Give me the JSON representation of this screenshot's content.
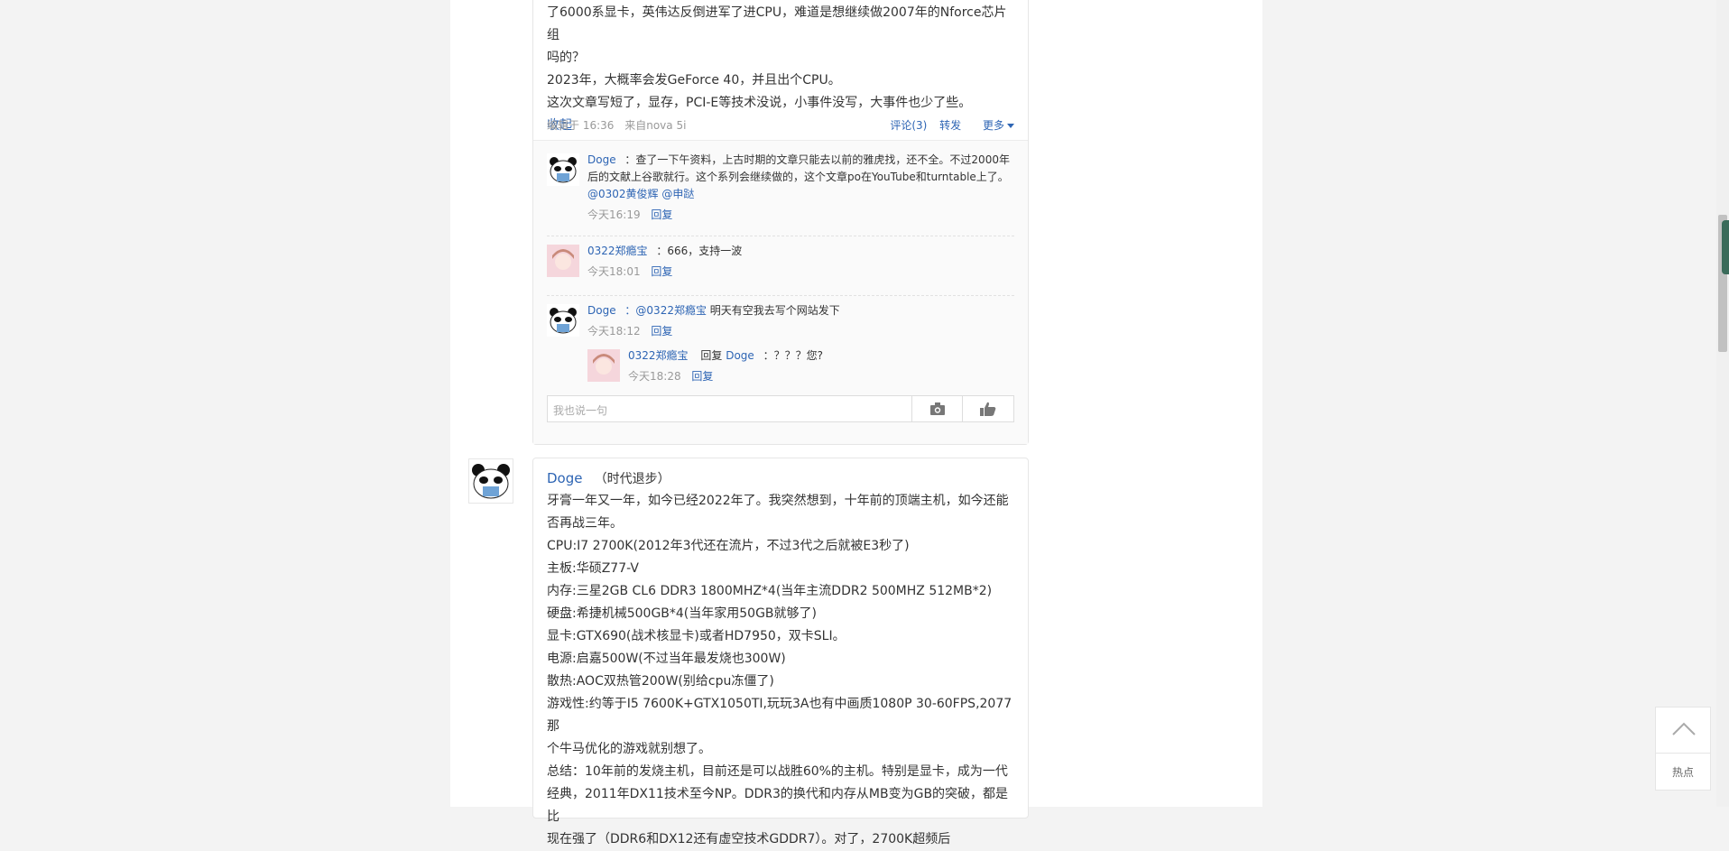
{
  "post1": {
    "lines": [
      "了6000系显卡，英伟达反倒进军了进CPU，难道是想继续做2007年的Nforce芯片组",
      "吗的？",
      " 2023年，大概率会发GeForce 40，并且出个CPU。",
      "这次文章写短了，显存，PCI-E等技术没说，小事件没写，大事件也少了些。"
    ],
    "collapse": "收起",
    "edited": "编辑于 16:36",
    "source": "来自nova 5i",
    "comments_link": "评论(3)",
    "forward_link": "转发",
    "more_link": "更多"
  },
  "comments": [
    {
      "user": "Doge",
      "text": "：查了一下午资料，上古时期的文章只能去以前的雅虎找，还不全。不过2000年后的文献上谷歌就行。这个系列会继续做的，这个文章po在YouTube和turntable上了。",
      "mentions": "@0302黄俊辉 @申跶",
      "time": "今天16:19",
      "reply": "回复"
    },
    {
      "user": "0322郑瘾宝",
      "text": "：666，支持一波",
      "time": "今天18:01",
      "reply": "回复"
    },
    {
      "user": "Doge",
      "mention": "：@0322郑瘾宝",
      "text": " 明天有空我去写个网站发下",
      "time": "今天18:12",
      "reply": "回复"
    },
    {
      "user": "0322郑瘾宝",
      "reply_word": "回复",
      "reply_to": "Doge",
      "text": "：？？？您?",
      "time": "今天18:28",
      "reply": "回复"
    }
  ],
  "reply_input": {
    "placeholder": "我也说一句"
  },
  "post2": {
    "author": "Doge",
    "tag": "（时代退步）",
    "lines": [
      "牙膏一年又一年，如今已经2022年了。我突然想到，十年前的顶端主机，如今还能",
      "否再战三年。",
      "CPU:I7 2700K(2012年3代还在流片，不过3代之后就被E3秒了)",
      "主板:华硕Z77-V",
      "内存:三星2GB CL6 DDR3 1800MHZ*4(当年主流DDR2 500MHZ 512MB*2)",
      "硬盘:希捷机械500GB*4(当年家用50GB就够了)",
      "显卡:GTX690(战术核显卡)或者HD7950，双卡SLI。",
      "电源:启嘉500W(不过当年最发烧也300W)",
      "散热:AOC双热管200W(别给cpu冻僵了)",
      "游戏性:约等于I5 7600K+GTX1050TI,玩玩3A也有中画质1080P 30-60FPS,2077那",
      "个牛马优化的游戏就别想了。",
      "总结：10年前的发烧主机，目前还是可以战胜60%的主机。特别是显卡，成为一代",
      "经典，2011年DX11技术至今NP。DDR3的换代和内存从MB变为GB的突破，都是比",
      "现在强了（DDR6和DX12还有虚空技术GDDR7）。对了，2700K超频后"
    ]
  },
  "float": {
    "hot_label": "热点"
  },
  "colors": {
    "link": "#2e65b4",
    "page_bg": "#f3f3f3"
  }
}
